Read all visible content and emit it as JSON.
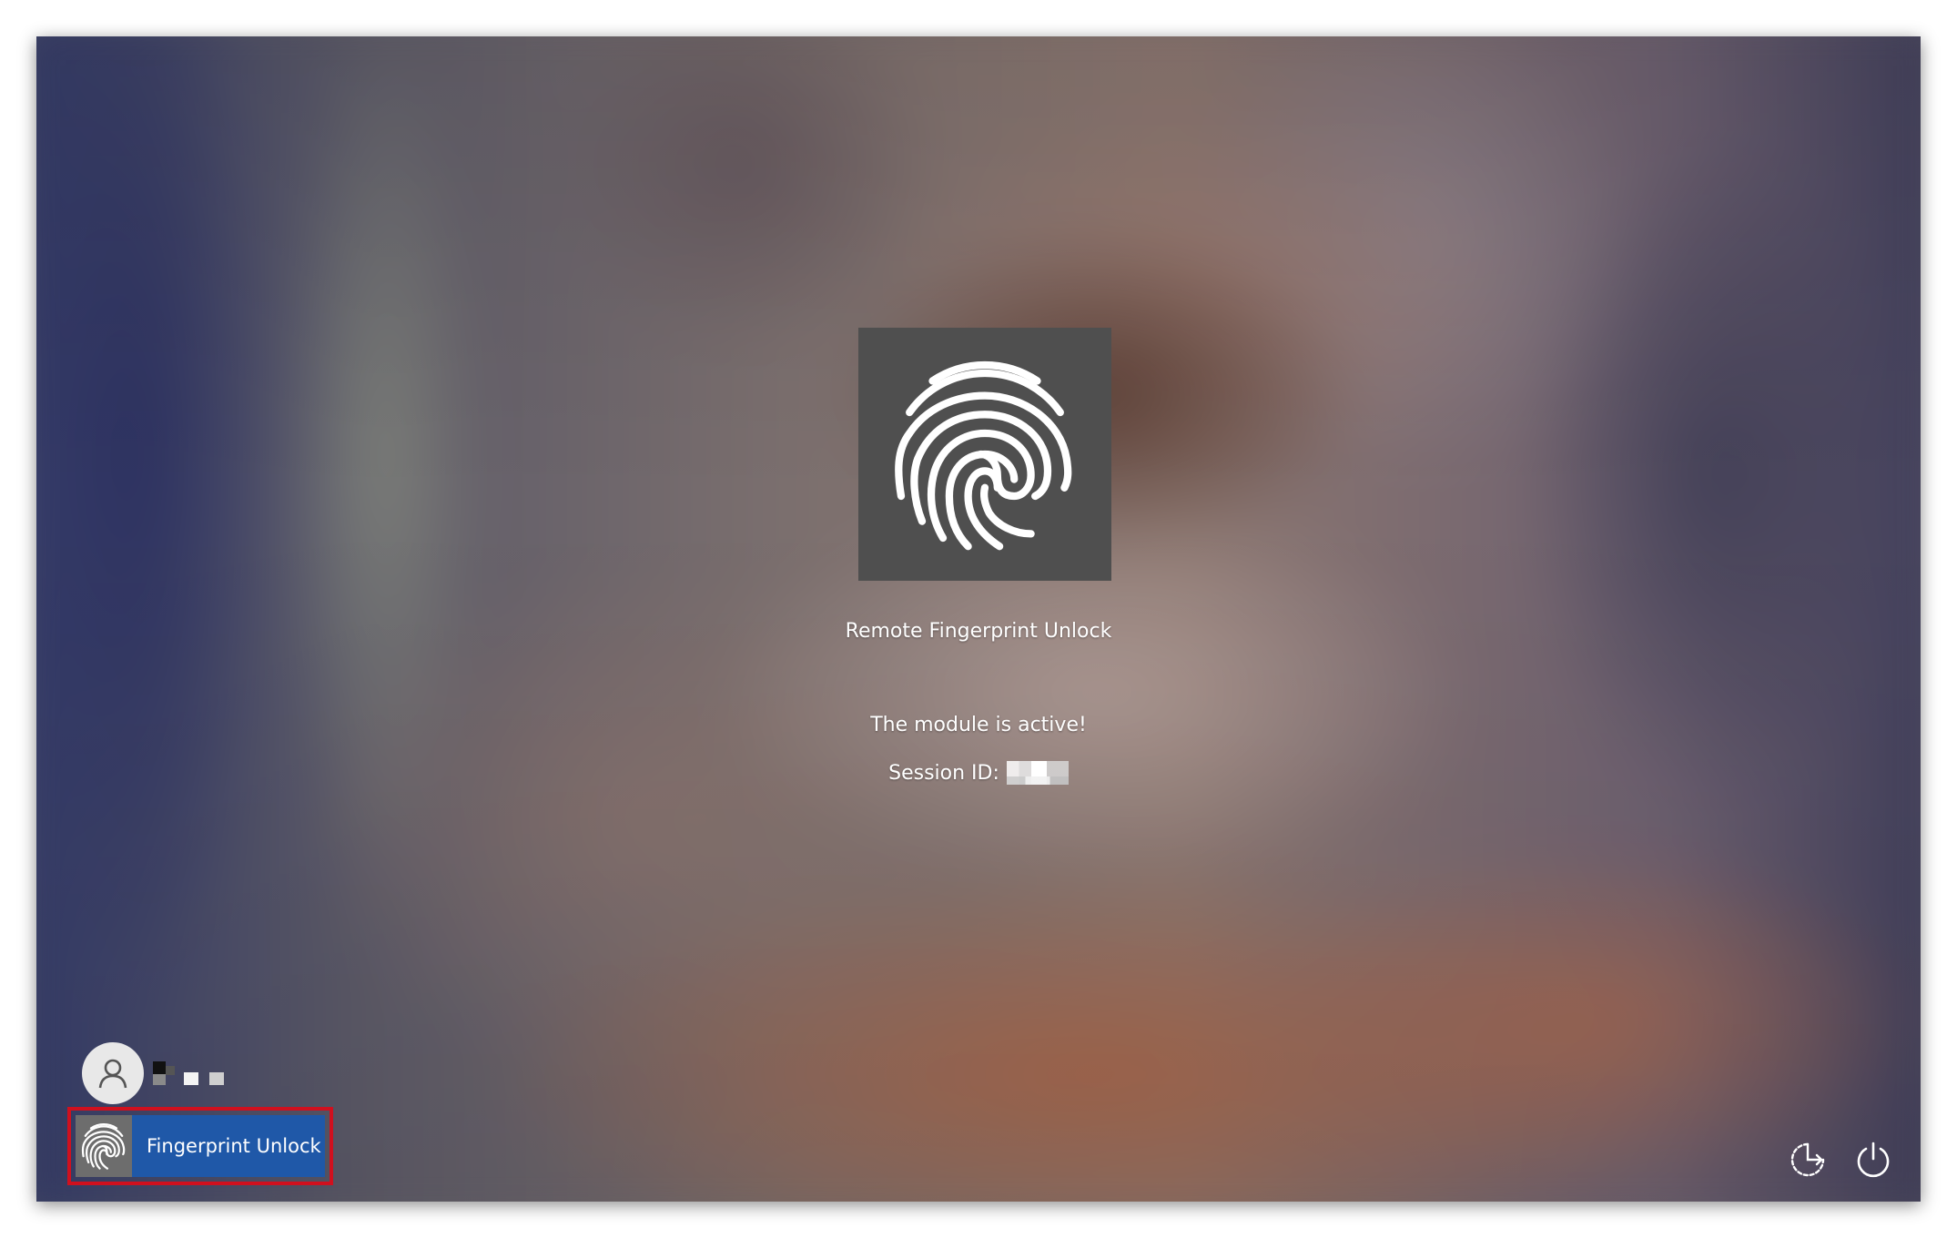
{
  "credential_tile": {
    "icon": "fingerprint-icon",
    "label": "Remote Fingerprint Unlock"
  },
  "status": {
    "message": "The module is active!",
    "session_label": "Session ID:",
    "session_value_redacted": true
  },
  "user": {
    "avatar_icon": "user-avatar-icon",
    "name_redacted": true
  },
  "sign_in_options": {
    "selected": {
      "icon": "fingerprint-icon",
      "label": "Fingerprint Unlock"
    }
  },
  "corner_buttons": {
    "accessibility_icon": "ease-of-access-icon",
    "power_icon": "power-icon"
  },
  "colors": {
    "tile_bg": "#4f4f4f",
    "provider_bg": "#1f58a8",
    "selection_outline": "#d0101e"
  }
}
